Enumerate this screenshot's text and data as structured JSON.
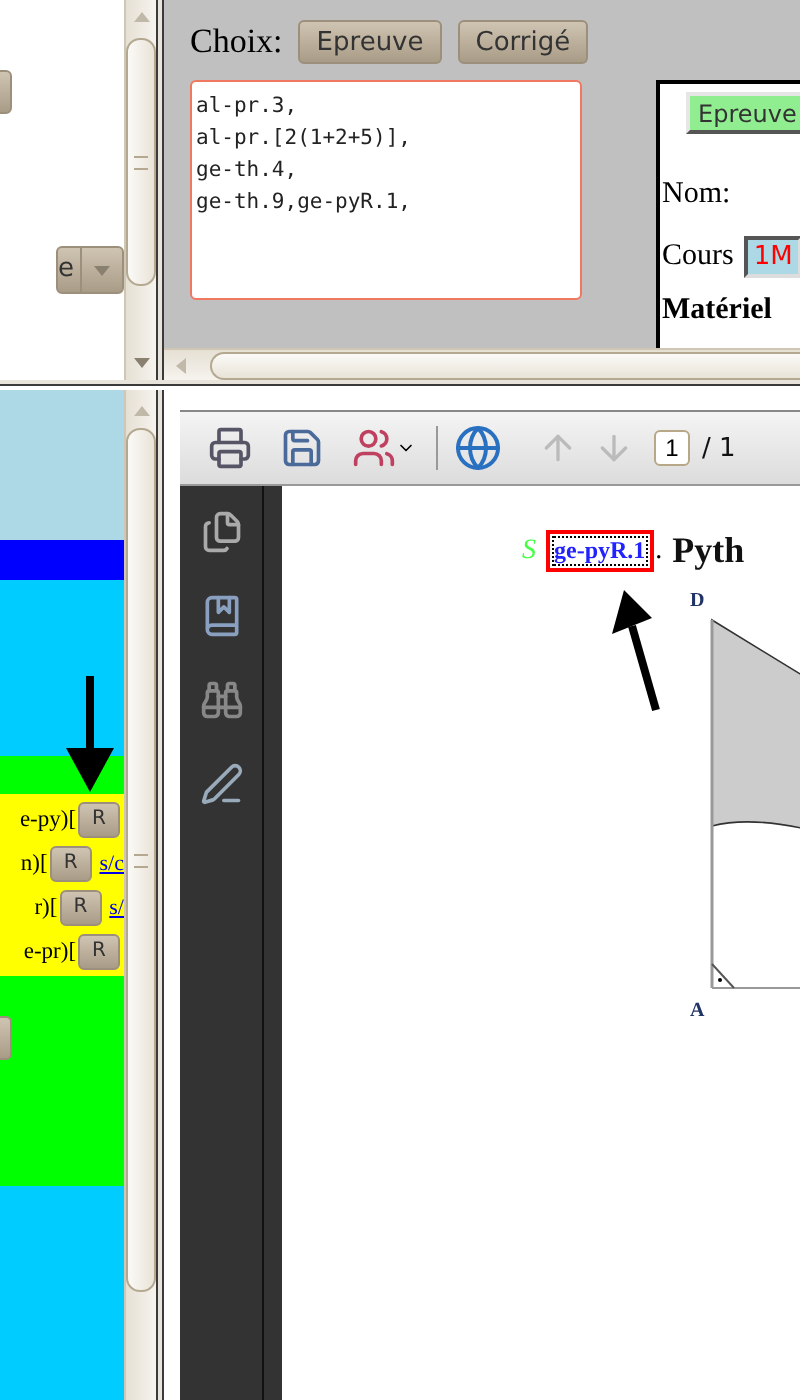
{
  "left_panel": {
    "select_value": "e",
    "rows": [
      {
        "text": "e-py)[",
        "button": "R"
      },
      {
        "text": "n)[",
        "button": "R",
        "link": "s/c"
      },
      {
        "text": "r)[",
        "button": "R",
        "link": "s/"
      },
      {
        "text": "e-pr)[",
        "button": "R"
      }
    ]
  },
  "choice": {
    "label": "Choix:",
    "buttons": [
      "Epreuve",
      "Corrigé"
    ],
    "lines": [
      "al-pr.3,",
      "al-pr.[2(1+2+5)],",
      "ge-th.4,",
      "ge-th.9,ge-pyR.1,"
    ]
  },
  "preview": {
    "button": "Epreuve",
    "name_label": "Nom:",
    "course_label": "Cours",
    "course_value": "1M",
    "heading": "Matériel"
  },
  "pdf_viewer": {
    "page_number": "1",
    "page_total": "/ 1",
    "document": {
      "marker": "S",
      "reference": "ge-pyR.1",
      "punctuation": ".",
      "title": "Pyth",
      "points": [
        "D",
        "A"
      ]
    }
  }
}
